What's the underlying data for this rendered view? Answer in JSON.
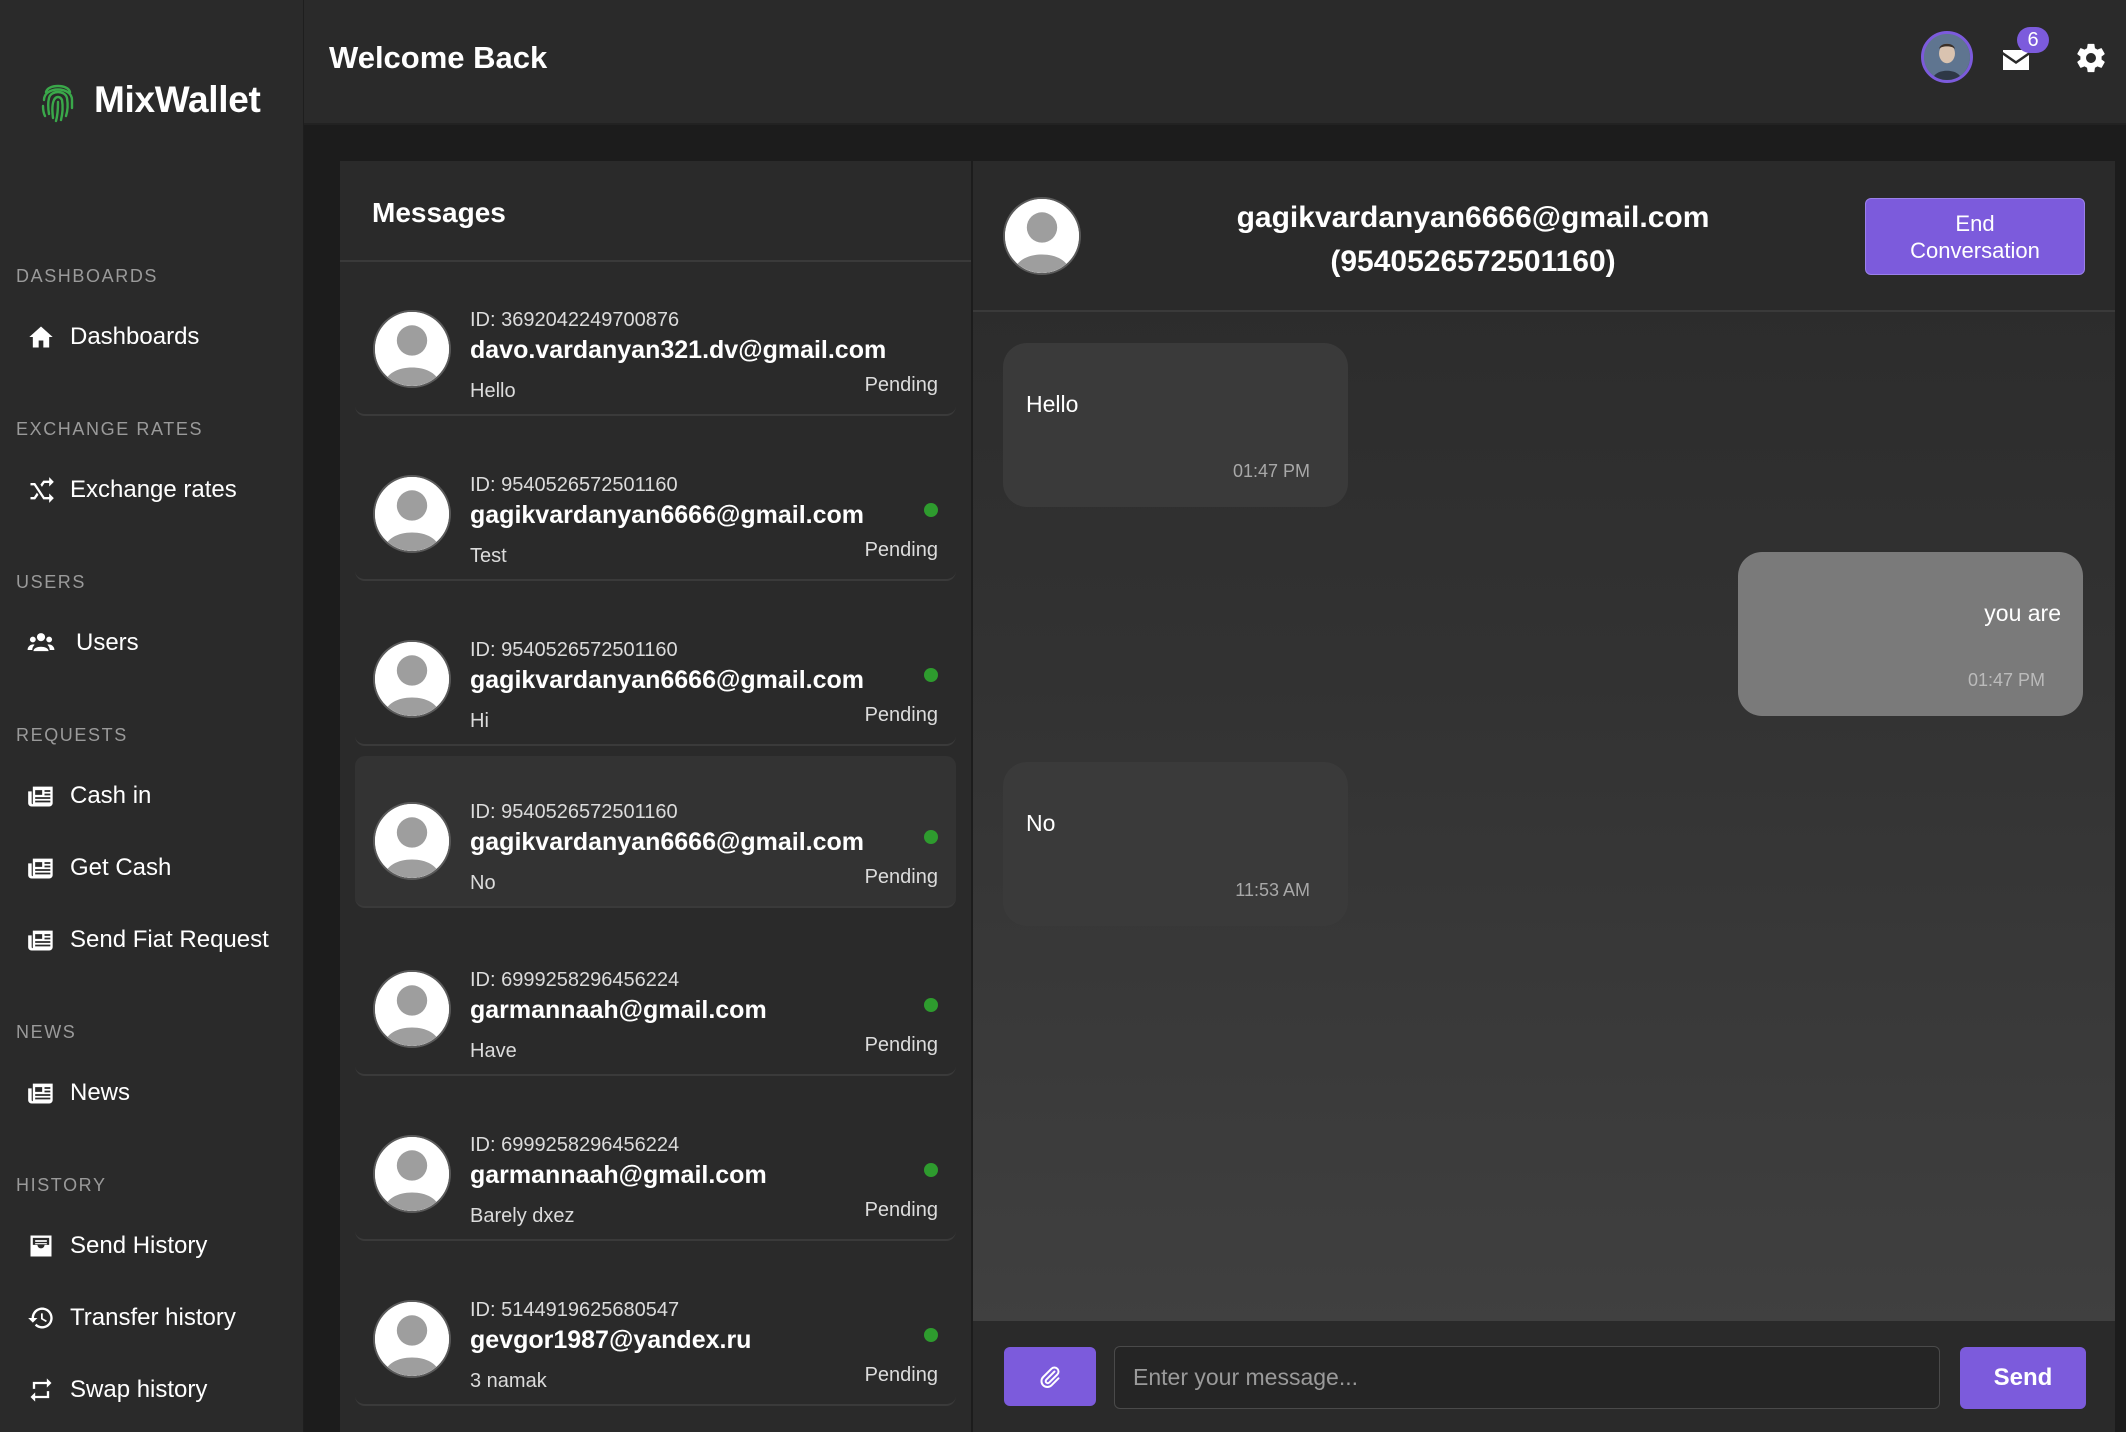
{
  "app": {
    "brand_name": "MixWallet",
    "icon": "fingerprint-icon"
  },
  "header": {
    "welcome": "Welcome Back",
    "mail_badge_count": "6",
    "icons": [
      "avatar",
      "mail-icon",
      "gear-icon"
    ]
  },
  "sidebar": {
    "sections": [
      {
        "title": "DASHBOARDS",
        "items": [
          {
            "label": "Dashboards",
            "icon": "home-icon"
          }
        ]
      },
      {
        "title": "EXCHANGE RATES",
        "items": [
          {
            "label": "Exchange rates",
            "icon": "shuffle-icon"
          }
        ]
      },
      {
        "title": "USERS",
        "items": [
          {
            "label": "Users",
            "icon": "users-icon"
          }
        ]
      },
      {
        "title": "REQUESTS",
        "items": [
          {
            "label": "Cash in",
            "icon": "newspaper-icon"
          },
          {
            "label": "Get Cash",
            "icon": "newspaper-icon"
          },
          {
            "label": "Send Fiat Request",
            "icon": "newspaper-icon"
          }
        ]
      },
      {
        "title": "NEWS",
        "items": [
          {
            "label": "News",
            "icon": "newspaper-icon"
          }
        ]
      },
      {
        "title": "HISTORY",
        "items": [
          {
            "label": "Send History",
            "icon": "inbox-icon"
          },
          {
            "label": "Transfer history",
            "icon": "history-icon"
          },
          {
            "label": "Swap history",
            "icon": "repeat-icon"
          }
        ]
      }
    ]
  },
  "messages": {
    "title": "Messages",
    "conversations": [
      {
        "id": "ID: 3692042249700876",
        "email": "davo.vardanyan321.dv@gmail.com",
        "last": "Hello",
        "status": "Pending",
        "online": false
      },
      {
        "id": "ID: 9540526572501160",
        "email": "gagikvardanyan6666@gmail.com",
        "last": "Test",
        "status": "Pending",
        "online": true
      },
      {
        "id": "ID: 9540526572501160",
        "email": "gagikvardanyan6666@gmail.com",
        "last": "Hi",
        "status": "Pending",
        "online": true
      },
      {
        "id": "ID: 9540526572501160",
        "email": "gagikvardanyan6666@gmail.com",
        "last": "No",
        "status": "Pending",
        "online": true,
        "active": true
      },
      {
        "id": "ID: 6999258296456224",
        "email": "garmannaah@gmail.com",
        "last": "Have",
        "status": "Pending",
        "online": true
      },
      {
        "id": "ID: 6999258296456224",
        "email": "garmannaah@gmail.com",
        "last": "Barely dxez",
        "status": "Pending",
        "online": true
      },
      {
        "id": "ID: 5144919625680547",
        "email": "gevgor1987@yandex.ru",
        "last": "3 namak",
        "status": "Pending",
        "online": true
      }
    ]
  },
  "chat": {
    "title_line1": "gagikvardanyan6666@gmail.com",
    "title_line2": "(9540526572501160)",
    "end_button": "End Conversation",
    "messages": [
      {
        "text": "Hello",
        "time": "01:47 PM",
        "direction": "in"
      },
      {
        "text": "you are",
        "time": "01:47 PM",
        "direction": "out"
      },
      {
        "text": "No",
        "time": "11:53 AM",
        "direction": "in"
      }
    ],
    "input_placeholder": "Enter your message...",
    "send_button": "Send"
  },
  "colors": {
    "accent": "#7c5bdc",
    "online": "#2e9b2e",
    "background": "#1c1c1c",
    "panel": "#2a2a2a"
  }
}
